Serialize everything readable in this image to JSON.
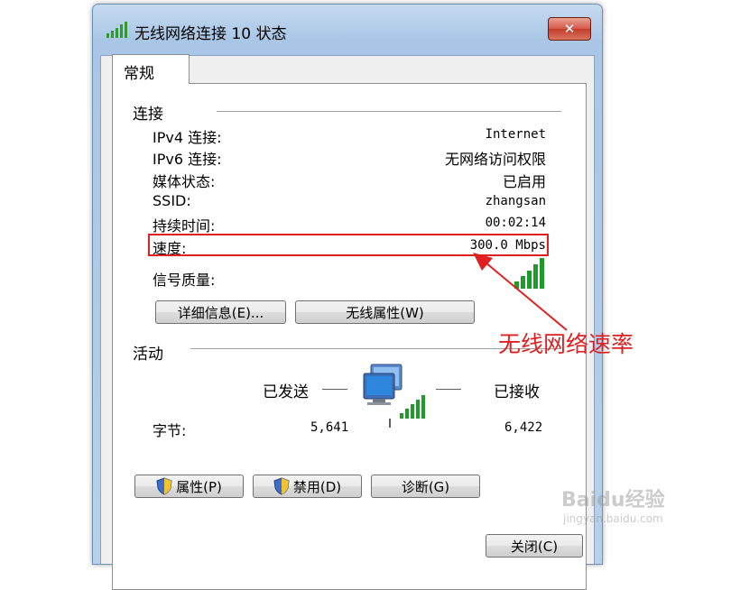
{
  "window": {
    "title": "无线网络连接 10 状态",
    "close_label": "✕"
  },
  "tabs": [
    {
      "label": "常规"
    }
  ],
  "connection": {
    "section_title": "连接",
    "rows": [
      {
        "label": "IPv4 连接:",
        "value": "Internet"
      },
      {
        "label": "IPv6 连接:",
        "value": "无网络访问权限"
      },
      {
        "label": "媒体状态:",
        "value": "已启用"
      },
      {
        "label": "SSID:",
        "value": "zhangsan"
      },
      {
        "label": "持续时间:",
        "value": "00:02:14"
      },
      {
        "label": "速度:",
        "value": "300.0 Mbps"
      }
    ],
    "signal_label": "信号质量:",
    "details_button": "详细信息(E)...",
    "wireless_props_button": "无线属性(W)"
  },
  "activity": {
    "section_title": "活动",
    "sent_label": "已发送",
    "received_label": "已接收",
    "bytes_label": "字节:",
    "bytes_sent": "5,641",
    "bytes_received": "6,422"
  },
  "buttons": {
    "properties": "属性(P)",
    "disable": "禁用(D)",
    "diagnose": "诊断(G)",
    "close": "关闭(C)"
  },
  "annotation": {
    "text": "无线网络速率",
    "color": "#e02020"
  },
  "watermark": {
    "brand": "Baidu经验",
    "url": "jingyan.baidu.com"
  },
  "icons": {
    "signal": "signal-bars-icon",
    "network": "network-computers-icon",
    "shield": "uac-shield-icon"
  }
}
